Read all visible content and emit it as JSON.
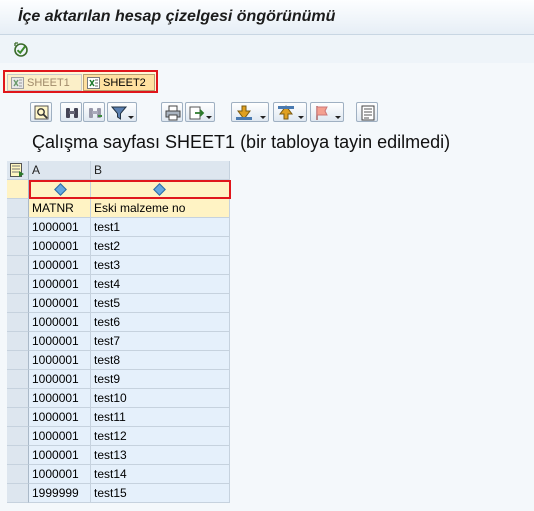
{
  "window": {
    "title": "İçe aktarılan hesap çizelgesi öngörünümü"
  },
  "toolbar": {
    "execute_icon": "execute-icon"
  },
  "tabs": [
    {
      "label": "SHEET1",
      "active": false,
      "icon": "excel-sheet-icon"
    },
    {
      "label": "SHEET2",
      "active": true,
      "icon": "excel-sheet-icon"
    }
  ],
  "grid_toolbar": {
    "buttons": [
      "details-icon",
      "find-icon",
      "find-next-icon",
      "filter-icon",
      "print-icon",
      "export-icon",
      "sort-ascending-icon",
      "sort-descending-icon",
      "flag-icon",
      "layout-icon"
    ]
  },
  "sheet": {
    "title": "Çalışma sayfası SHEET1 (bir tabloya tayin edilmedi)"
  },
  "table": {
    "columns": [
      "A",
      "B"
    ],
    "field_names": [
      "MATNR",
      "Eski malzeme no"
    ],
    "rows": [
      [
        "1000001",
        "test1"
      ],
      [
        "1000001",
        "test2"
      ],
      [
        "1000001",
        "test3"
      ],
      [
        "1000001",
        "test4"
      ],
      [
        "1000001",
        "test5"
      ],
      [
        "1000001",
        "test6"
      ],
      [
        "1000001",
        "test7"
      ],
      [
        "1000001",
        "test8"
      ],
      [
        "1000001",
        "test9"
      ],
      [
        "1000001",
        "test10"
      ],
      [
        "1000001",
        "test11"
      ],
      [
        "1000001",
        "test12"
      ],
      [
        "1000001",
        "test13"
      ],
      [
        "1000001",
        "test14"
      ],
      [
        "1999999",
        "test15"
      ]
    ]
  },
  "colors": {
    "highlight_border": "#e0161b",
    "cell_bg": "#e5f0fb",
    "header_bg": "#dde6ef"
  }
}
